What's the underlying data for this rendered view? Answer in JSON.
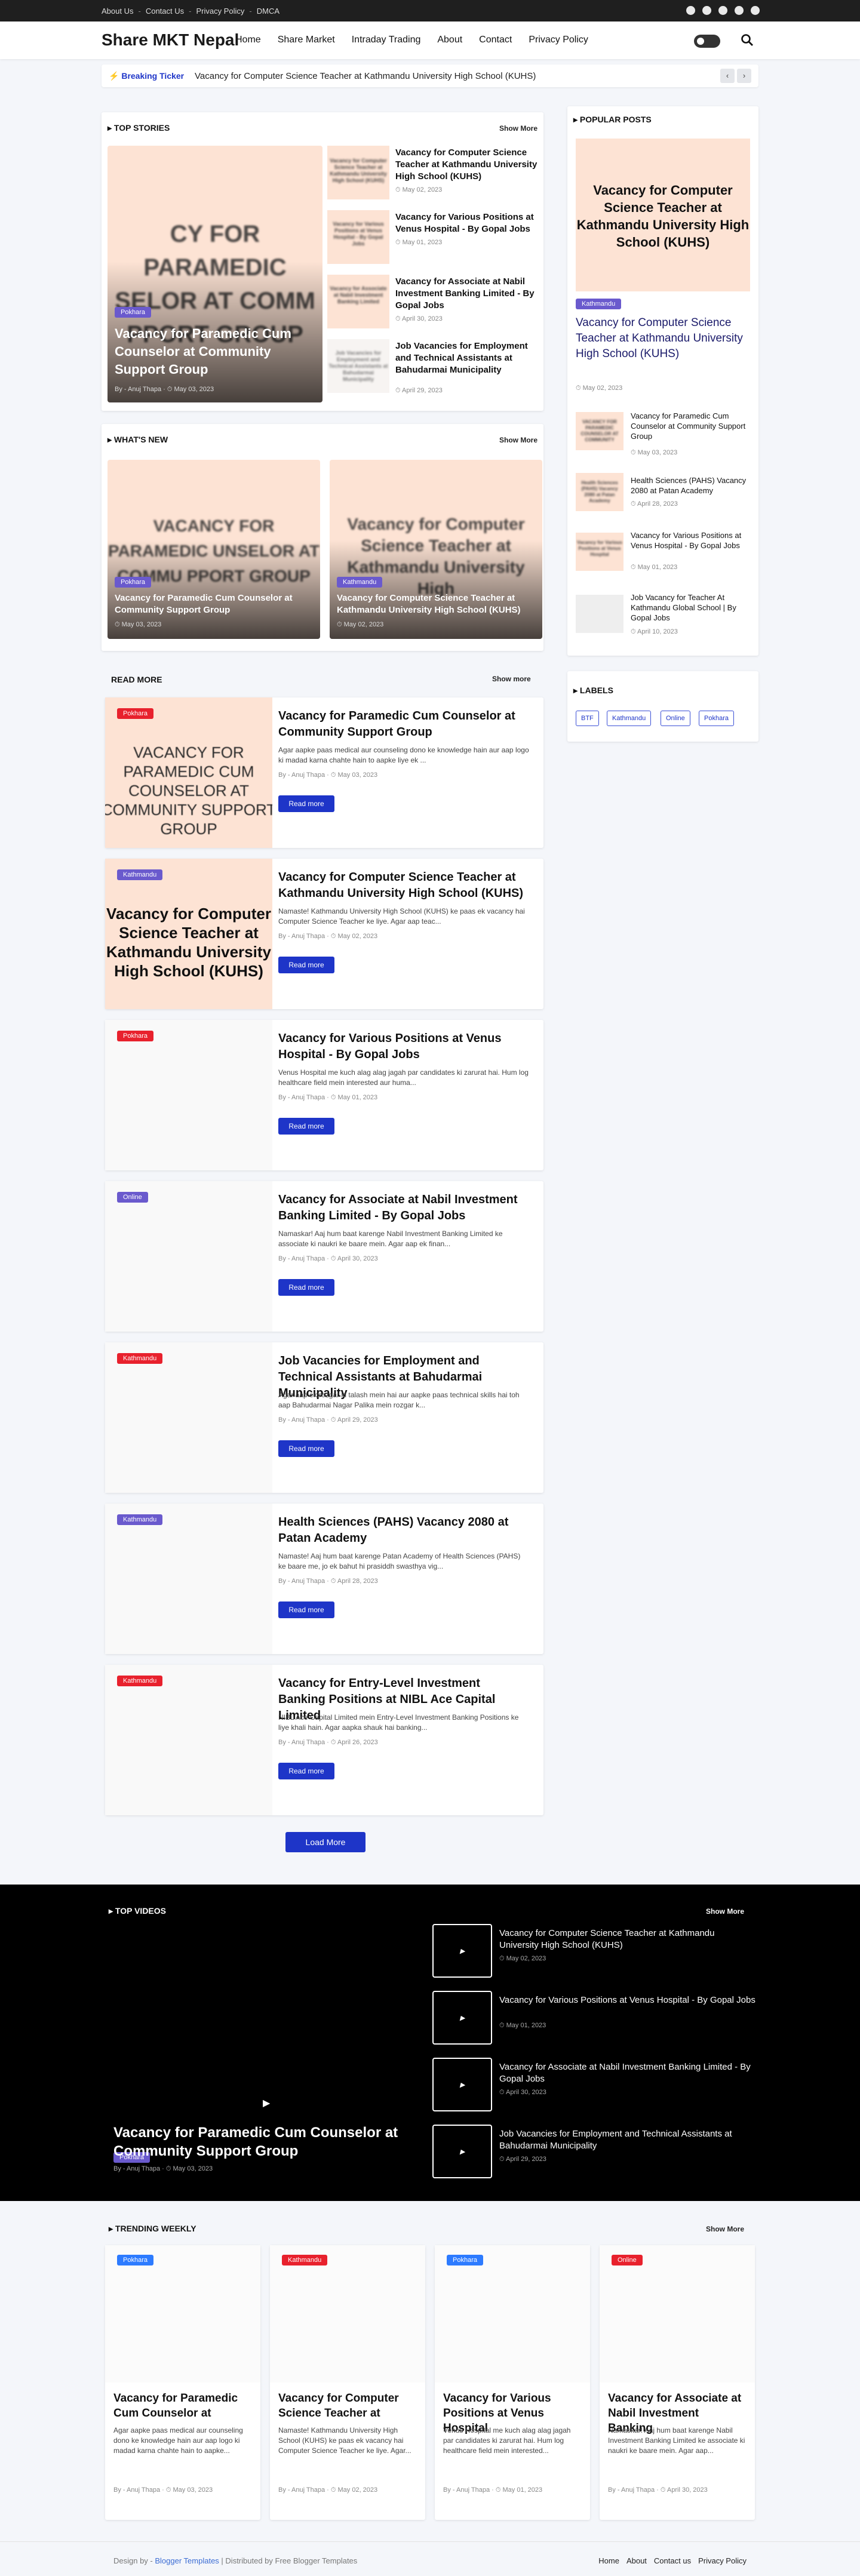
{
  "topbar": {
    "links": [
      "About Us",
      "Contact Us",
      "Privacy Policy",
      "DMCA"
    ],
    "social_icons": [
      "facebook-icon",
      "whatsapp-icon",
      "reddit-icon",
      "twitter-icon",
      "telegram-icon"
    ]
  },
  "header": {
    "logo": "Share MKT Nepal",
    "nav": [
      "Home",
      "Share Market",
      "Intraday Trading",
      "About",
      "Contact",
      "Privacy Policy"
    ]
  },
  "ticker": {
    "label": "Breaking Ticker",
    "text": "Vacancy for Computer Science Teacher at Kathmandu University High School (KUHS)"
  },
  "top_stories": {
    "heading": "TOP STORIES",
    "show_more": "Show More",
    "main": {
      "badge": "Pokhara",
      "thumb_text": "CY FOR PARAMEDIC SELOR AT COMM PPORT GROUP",
      "title": "Vacancy for Paramedic Cum Counselor at Community Support Group",
      "author": "By - Anuj Thapa",
      "date": "May 03, 2023"
    },
    "list": [
      {
        "thumb_text": "Vacancy for Computer Science Teacher at Kathmandu University High School (KUHS)",
        "title": "Vacancy for Computer Science Teacher at Kathmandu University High School (KUHS)",
        "date": "May 02, 2023"
      },
      {
        "thumb_text": "Vacancy for Various Positions at Venus Hospital - By Gopal Jobs",
        "title": "Vacancy for Various Positions at Venus Hospital - By Gopal Jobs",
        "date": "May 01, 2023"
      },
      {
        "thumb_text": "Vacancy for Associate at Nabil Investment Banking Limited",
        "title": "Vacancy for Associate at Nabil Investment Banking Limited - By Gopal Jobs",
        "date": "April 30, 2023"
      },
      {
        "thumb_text": "Job Vacancies for Employment and Technical Assistants at Bahudarmai Municipality",
        "title": "Job Vacancies for Employment and Technical Assistants at Bahudarmai Municipality",
        "date": "April 29, 2023"
      }
    ]
  },
  "whats_new": {
    "heading": "WHAT'S NEW",
    "show_more": "Show More",
    "items": [
      {
        "badge": "Pokhara",
        "thumb_text": "VACANCY FOR PARAMEDIC UNSELOR AT COMMU PPORT GROUP",
        "title": "Vacancy for Paramedic Cum Counselor at Community Support Group",
        "date": "May 03, 2023"
      },
      {
        "badge": "Kathmandu",
        "thumb_text": "Vacancy for Computer Science Teacher at Kathmandu University High",
        "title": "Vacancy for Computer Science Teacher at Kathmandu University High School (KUHS)",
        "date": "May 02, 2023"
      }
    ]
  },
  "read_more": {
    "heading": "READ MORE",
    "show_more": "Show more",
    "button": "Read more",
    "load_more": "Load More",
    "items": [
      {
        "badge": "Pokhara",
        "badge_color": "red",
        "thumb_text": "VACANCY FOR PARAMEDIC CUM COUNSELOR AT COMMUNITY SUPPORT GROUP",
        "title": "Vacancy for Paramedic Cum Counselor at Community Support Group",
        "excerpt": "Agar aapke paas medical aur counseling dono ke knowledge hain aur aap logo ki madad karna chahte hain to aapke liye ek ...",
        "author": "By - Anuj Thapa",
        "date": "May 03, 2023"
      },
      {
        "badge": "Kathmandu",
        "badge_color": "purple",
        "thumb_text": "Vacancy for Computer Science Teacher at Kathmandu University High School (KUHS)",
        "title": "Vacancy for Computer Science Teacher at Kathmandu University High School (KUHS)",
        "excerpt": "Namaste! Kathmandu University High School (KUHS) ke paas ek vacancy hai Computer Science Teacher ke liye. Agar aap teac...",
        "author": "By - Anuj Thapa",
        "date": "May 02, 2023"
      },
      {
        "badge": "Pokhara",
        "badge_color": "red",
        "thumb_text": "",
        "title": "Vacancy for Various Positions at Venus Hospital - By Gopal Jobs",
        "excerpt": "Venus Hospital me kuch alag alag jagah par candidates ki zarurat hai. Hum log healthcare field mein interested aur huma...",
        "author": "By - Anuj Thapa",
        "date": "May 01, 2023"
      },
      {
        "badge": "Online",
        "badge_color": "purple",
        "thumb_text": "",
        "title": "Vacancy for Associate at Nabil Investment Banking Limited - By Gopal Jobs",
        "excerpt": "Namaskar! Aaj hum baat karenge Nabil Investment Banking Limited ke associate ki naukri ke baare mein. Agar aap ek finan...",
        "author": "By - Anuj Thapa",
        "date": "April 30, 2023"
      },
      {
        "badge": "Kathmandu",
        "badge_color": "red",
        "thumb_text": "",
        "title": "Job Vacancies for Employment and Technical Assistants at Bahudarmai Municipality",
        "excerpt": "Agar aap ek rozgar ki talash mein hai aur aapke paas technical skills hai toh aap Bahudarmai Nagar Palika mein rozgar k...",
        "author": "By - Anuj Thapa",
        "date": "April 29, 2023"
      },
      {
        "badge": "Kathmandu",
        "badge_color": "purple",
        "thumb_text": "",
        "title": "Health Sciences (PAHS) Vacancy 2080 at Patan Academy",
        "excerpt": "Namaste! Aaj hum baat karenge Patan Academy of Health Sciences (PAHS) ke baare me, jo ek bahut hi prasiddh swasthya vig...",
        "author": "By - Anuj Thapa",
        "date": "April 28, 2023"
      },
      {
        "badge": "Kathmandu",
        "badge_color": "red",
        "thumb_text": "",
        "title": "Vacancy for Entry-Level Investment Banking Positions at NIBL Ace Capital Limited",
        "excerpt": "NIBL Ace Capital Limited mein Entry-Level Investment Banking Positions ke liye khali hain. Agar aapka shauk hai banking...",
        "author": "By - Anuj Thapa",
        "date": "April 26, 2023"
      }
    ]
  },
  "sidebar": {
    "popular_heading": "POPULAR POSTS",
    "featured": {
      "badge": "Kathmandu",
      "thumb_text": "Vacancy for Computer Science Teacher at Kathmandu University High School (KUHS)",
      "title": "Vacancy for Computer Science Teacher at Kathmandu University High School (KUHS)",
      "date": "May 02, 2023"
    },
    "posts": [
      {
        "thumb_text": "VACANCY FOR PARAMEDIC COUNSELOR AT COMMUNITY",
        "title": "Vacancy for Paramedic Cum Counselor at Community Support Group",
        "date": "May 03, 2023"
      },
      {
        "thumb_text": "Health Sciences (PAHS) Vacancy 2080 at Patan Academy",
        "title": "Health Sciences (PAHS) Vacancy 2080 at Patan Academy",
        "date": "April 28, 2023"
      },
      {
        "thumb_text": "Vacancy for Various Positions at Venus Hospital",
        "title": "Vacancy for Various Positions at Venus Hospital - By Gopal Jobs",
        "date": "May 01, 2023"
      },
      {
        "thumb_text": "",
        "title": "Job Vacancy for Teacher At Kathmandu Global School | By Gopal Jobs",
        "date": "April 10, 2023"
      }
    ],
    "labels_heading": "LABELS",
    "labels": [
      "BTF",
      "Kathmandu",
      "Online",
      "Pokhara"
    ]
  },
  "top_videos": {
    "heading": "TOP VIDEOS",
    "show_more": "Show More",
    "main": {
      "badge": "Pokhara",
      "title": "Vacancy for Paramedic Cum Counselor at Community Support Group",
      "author": "By - Anuj Thapa",
      "date": "May 03, 2023"
    },
    "list": [
      {
        "title": "Vacancy for Computer Science Teacher at Kathmandu University High School (KUHS)",
        "date": "May 02, 2023"
      },
      {
        "title": "Vacancy for Various Positions at Venus Hospital - By Gopal Jobs",
        "date": "May 01, 2023"
      },
      {
        "title": "Vacancy for Associate at Nabil Investment Banking Limited - By Gopal Jobs",
        "date": "April 30, 2023"
      },
      {
        "title": "Job Vacancies for Employment and Technical Assistants at Bahudarmai Municipality",
        "date": "April 29, 2023"
      }
    ]
  },
  "trending": {
    "heading": "TRENDING WEEKLY",
    "show_more": "Show More",
    "items": [
      {
        "badge": "Pokhara",
        "badge_color": "blue",
        "title": "Vacancy for Paramedic Cum Counselor at",
        "excerpt": "Agar aapke paas medical aur counseling dono ke knowledge hain aur aap logo ki madad karna chahte hain to aapke...",
        "author": "By - Anuj Thapa",
        "date": "May 03, 2023"
      },
      {
        "badge": "Kathmandu",
        "badge_color": "red",
        "title": "Vacancy for Computer Science Teacher at",
        "excerpt": "Namaste! Kathmandu University High School (KUHS) ke paas ek vacancy hai Computer Science Teacher ke liye. Agar...",
        "author": "By - Anuj Thapa",
        "date": "May 02, 2023"
      },
      {
        "badge": "Pokhara",
        "badge_color": "blue",
        "title": "Vacancy for Various Positions at Venus Hospital",
        "excerpt": "Venus Hospital me kuch alag alag jagah par candidates ki zarurat hai. Hum log healthcare field mein interested...",
        "author": "By - Anuj Thapa",
        "date": "May 01, 2023"
      },
      {
        "badge": "Online",
        "badge_color": "red",
        "title": "Vacancy for Associate at Nabil Investment Banking",
        "excerpt": "Namaskar! Aaj hum baat karenge Nabil Investment Banking Limited ke associate ki naukri ke baare mein. Agar aap...",
        "author": "By - Anuj Thapa",
        "date": "April 30, 2023"
      }
    ]
  },
  "footer": {
    "design_by": "Design by - ",
    "blogger_templates": "Blogger Templates",
    "separator": " | ",
    "distributed": "Distributed by Free Blogger Templates",
    "links": [
      "Home",
      "About",
      "Contact us",
      "Privacy Policy"
    ]
  }
}
